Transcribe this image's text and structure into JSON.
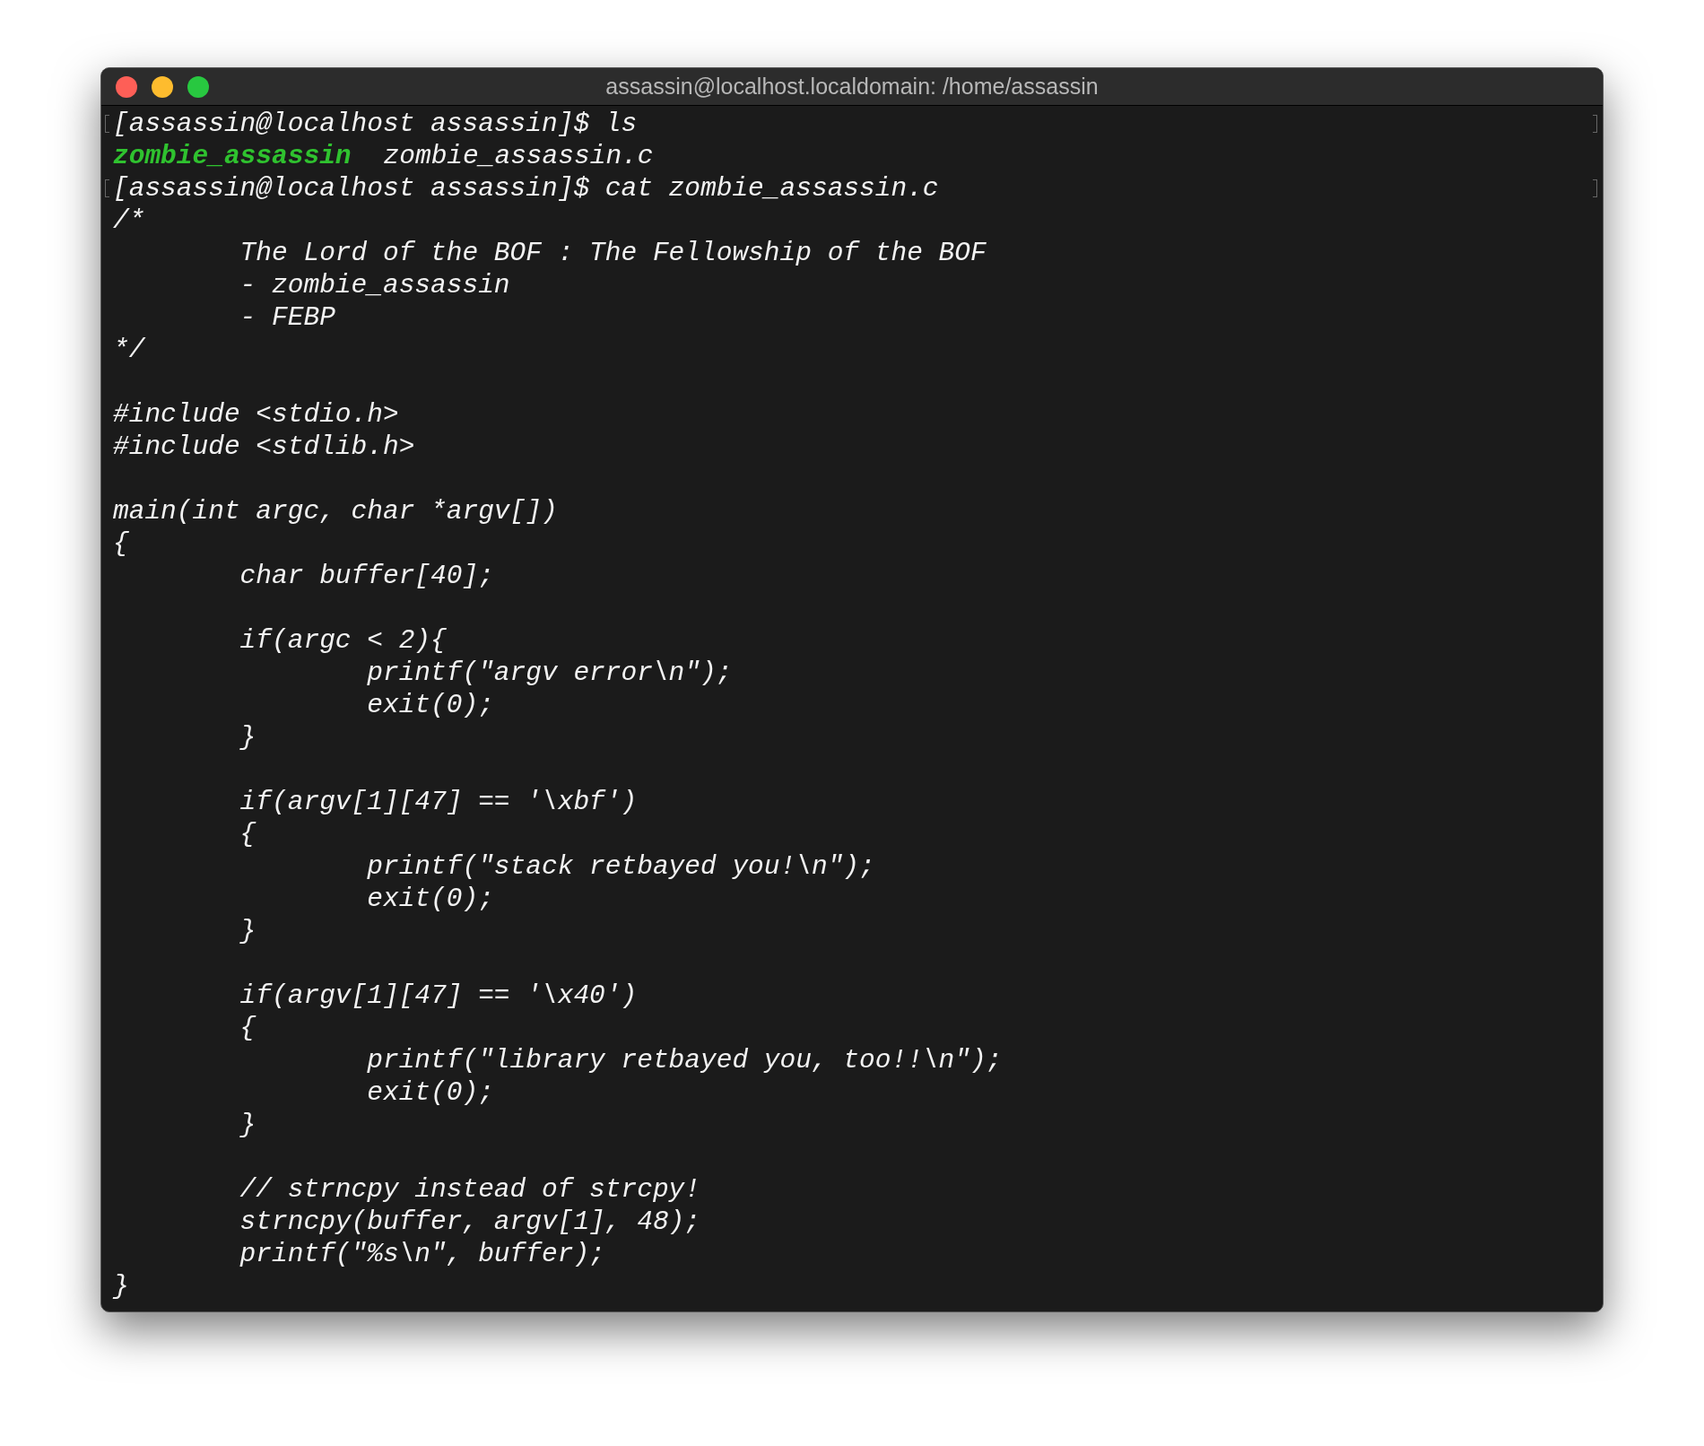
{
  "window": {
    "title": "assassin@localhost.localdomain: /home/assassin"
  },
  "lines": [
    {
      "kind": "prompt",
      "text": "[assassin@localhost assassin]$ ls"
    },
    {
      "kind": "listing",
      "entries": [
        {
          "kind": "executable",
          "text": "zombie_assassin"
        },
        {
          "kind": "file",
          "text": "zombie_assassin.c"
        }
      ]
    },
    {
      "kind": "prompt",
      "text": "[assassin@localhost assassin]$ cat zombie_assassin.c"
    },
    {
      "kind": "code",
      "text": "/*"
    },
    {
      "kind": "code",
      "text": "        The Lord of the BOF : The Fellowship of the BOF"
    },
    {
      "kind": "code",
      "text": "        - zombie_assassin"
    },
    {
      "kind": "code",
      "text": "        - FEBP"
    },
    {
      "kind": "code",
      "text": "*/"
    },
    {
      "kind": "blank"
    },
    {
      "kind": "code",
      "text": "#include <stdio.h>"
    },
    {
      "kind": "code",
      "text": "#include <stdlib.h>"
    },
    {
      "kind": "blank"
    },
    {
      "kind": "code",
      "text": "main(int argc, char *argv[])"
    },
    {
      "kind": "code",
      "text": "{"
    },
    {
      "kind": "code",
      "text": "        char buffer[40];"
    },
    {
      "kind": "blank"
    },
    {
      "kind": "code",
      "text": "        if(argc < 2){"
    },
    {
      "kind": "code",
      "text": "                printf(\"argv error\\n\");"
    },
    {
      "kind": "code",
      "text": "                exit(0);"
    },
    {
      "kind": "code",
      "text": "        }"
    },
    {
      "kind": "blank"
    },
    {
      "kind": "code",
      "text": "        if(argv[1][47] == '\\xbf')"
    },
    {
      "kind": "code",
      "text": "        {"
    },
    {
      "kind": "code",
      "text": "                printf(\"stack retbayed you!\\n\");"
    },
    {
      "kind": "code",
      "text": "                exit(0);"
    },
    {
      "kind": "code",
      "text": "        }"
    },
    {
      "kind": "blank"
    },
    {
      "kind": "code",
      "text": "        if(argv[1][47] == '\\x40')"
    },
    {
      "kind": "code",
      "text": "        {"
    },
    {
      "kind": "code",
      "text": "                printf(\"library retbayed you, too!!\\n\");"
    },
    {
      "kind": "code",
      "text": "                exit(0);"
    },
    {
      "kind": "code",
      "text": "        }"
    },
    {
      "kind": "blank"
    },
    {
      "kind": "code",
      "text": "        // strncpy instead of strcpy!"
    },
    {
      "kind": "code",
      "text": "        strncpy(buffer, argv[1], 48);"
    },
    {
      "kind": "code",
      "text": "        printf(\"%s\\n\", buffer);"
    },
    {
      "kind": "code",
      "text": "}"
    }
  ]
}
